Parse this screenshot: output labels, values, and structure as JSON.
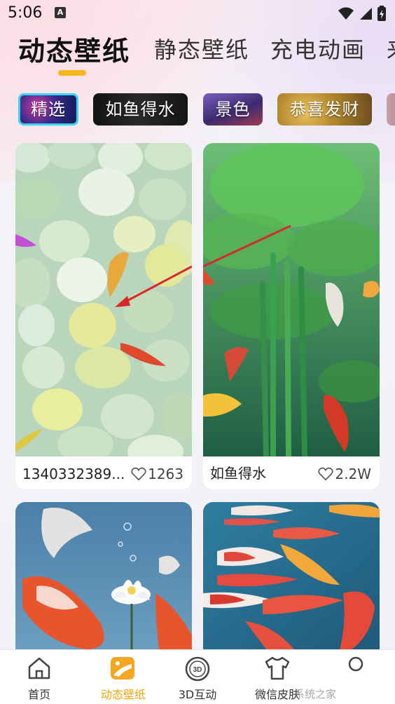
{
  "status_bar": {
    "time": "5:06",
    "notification_badge": "A"
  },
  "top_tabs": [
    {
      "label": "动态壁纸",
      "active": true
    },
    {
      "label": "静态壁纸",
      "active": false
    },
    {
      "label": "充电动画",
      "active": false
    },
    {
      "label": "来",
      "active": false
    }
  ],
  "chips": [
    {
      "label": "精选",
      "selected": true
    },
    {
      "label": "如鱼得水",
      "selected": false
    },
    {
      "label": "景色",
      "selected": false
    },
    {
      "label": "恭喜发财",
      "selected": false
    }
  ],
  "cards": [
    {
      "title": "1340332389...",
      "likes": "1263",
      "image": "koi-on-pebbles"
    },
    {
      "title": "如鱼得水",
      "likes": "2.2W",
      "image": "koi-and-bamboo"
    },
    {
      "title": "",
      "likes": "",
      "image": "koi-and-lotus"
    },
    {
      "title": "",
      "likes": "",
      "image": "koi-in-pond"
    }
  ],
  "bottom_nav": [
    {
      "label": "首页",
      "icon": "home-icon",
      "active": false
    },
    {
      "label": "动态壁纸",
      "icon": "wallpaper-icon",
      "active": true
    },
    {
      "label": "3D互动",
      "icon": "3d-icon",
      "active": false
    },
    {
      "label": "微信皮肤",
      "icon": "tshirt-icon",
      "active": false
    },
    {
      "label": "",
      "icon": "circle-icon",
      "active": false
    }
  ],
  "watermark": "系统之家",
  "colors": {
    "accent": "#f6b81c",
    "active_nav": "#f2a40c",
    "arrow": "#d8282a"
  }
}
